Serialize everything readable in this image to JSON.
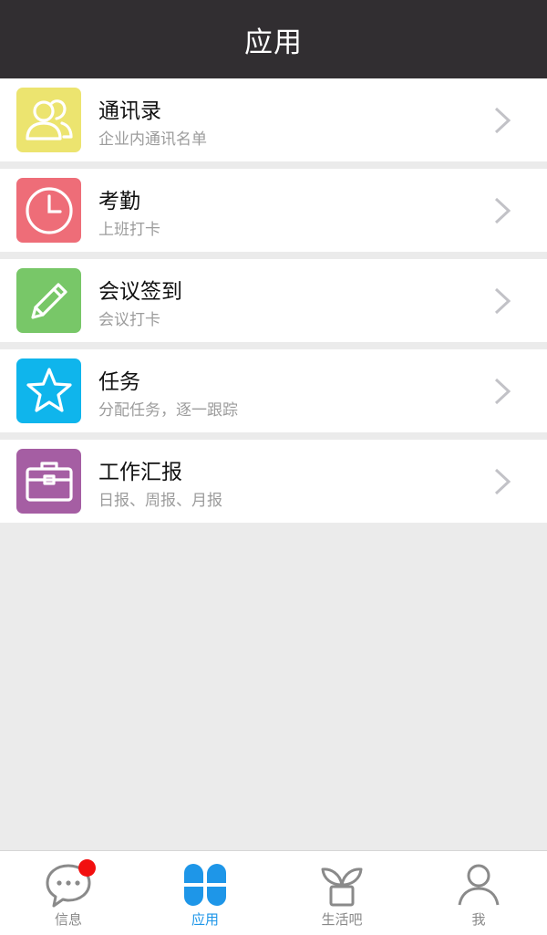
{
  "header": {
    "title": "应用"
  },
  "apps": [
    {
      "name": "通讯录",
      "subtitle": "企业内通讯名单",
      "icon": "contacts-icon",
      "color": "#ece46f"
    },
    {
      "name": "考勤",
      "subtitle": "上班打卡",
      "icon": "clock-icon",
      "color": "#ee6d78"
    },
    {
      "name": "会议签到",
      "subtitle": "会议打卡",
      "icon": "pencil-icon",
      "color": "#78c768"
    },
    {
      "name": "任务",
      "subtitle": "分配任务，逐一跟踪",
      "icon": "star-icon",
      "color": "#0fb5ec"
    },
    {
      "name": "工作汇报",
      "subtitle": "日报、周报、月报",
      "icon": "briefcase-icon",
      "color": "#a55ea3"
    }
  ],
  "tabs": [
    {
      "label": "信息",
      "icon": "chat-bubble-icon",
      "has_badge": true
    },
    {
      "label": "应用",
      "icon": "apps-clover-icon",
      "active": true
    },
    {
      "label": "生活吧",
      "icon": "plant-pot-icon"
    },
    {
      "label": "我",
      "icon": "person-icon"
    }
  ],
  "colors": {
    "header_bg": "#312e31",
    "active_tab": "#1e96e8",
    "badge": "#f20f0f"
  }
}
